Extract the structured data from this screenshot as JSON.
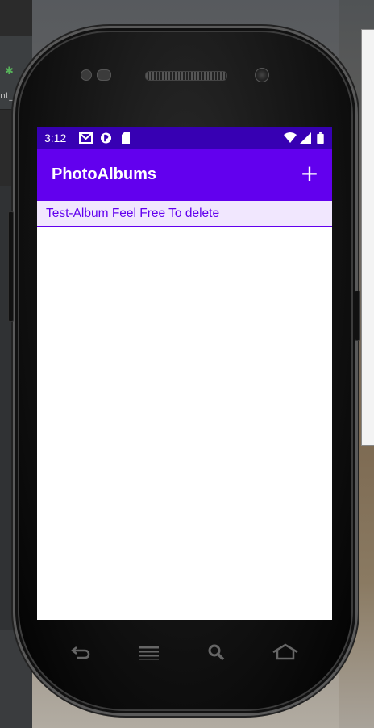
{
  "background": {
    "ide_tab_text": "nt_"
  },
  "status_bar": {
    "time": "3:12",
    "icons_left": [
      "gmail-icon",
      "account-icon",
      "sdcard-icon"
    ],
    "icons_right": [
      "wifi-icon",
      "signal-icon",
      "battery-icon"
    ],
    "color": "#3700b3"
  },
  "app_bar": {
    "title": "PhotoAlbums",
    "add_label": "+",
    "color": "#6200ee"
  },
  "albums": [
    {
      "name": "Test-Album Feel Free To delete"
    }
  ],
  "nav_bar": {
    "buttons": [
      "back-icon",
      "menu-icon",
      "search-icon",
      "home-icon"
    ]
  }
}
